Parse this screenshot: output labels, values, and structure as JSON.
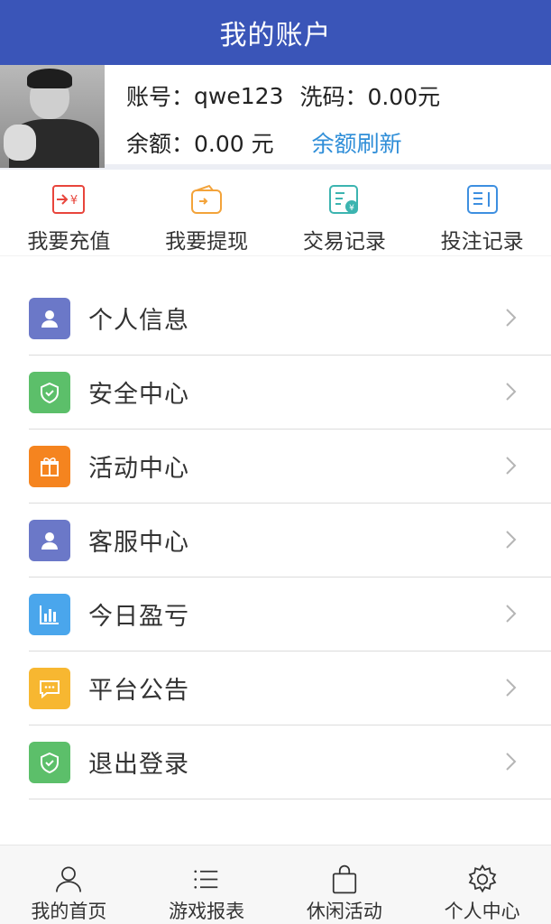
{
  "header": {
    "title": "我的账户"
  },
  "account": {
    "account_label": "账号：",
    "account_value": "qwe123",
    "wash_label": "洗码：",
    "wash_value": "0.00元",
    "balance_label": "余额：",
    "balance_value": "0.00 元",
    "refresh_label": "余额刷新"
  },
  "quick_actions": [
    {
      "label": "我要充值",
      "icon": "recharge-icon",
      "color": "#e8453c"
    },
    {
      "label": "我要提现",
      "icon": "wallet-icon",
      "color": "#f3a33a"
    },
    {
      "label": "交易记录",
      "icon": "transaction-record-icon",
      "color": "#3cb4b0"
    },
    {
      "label": "投注记录",
      "icon": "bet-record-icon",
      "color": "#3d8fe0"
    }
  ],
  "menu": [
    {
      "label": "个人信息",
      "icon": "user-icon",
      "color": "#6b78c8"
    },
    {
      "label": "安全中心",
      "icon": "shield-icon",
      "color": "#5cbf6a"
    },
    {
      "label": "活动中心",
      "icon": "gift-icon",
      "color": "#f5841f"
    },
    {
      "label": "客服中心",
      "icon": "user-icon",
      "color": "#6b78c8"
    },
    {
      "label": "今日盈亏",
      "icon": "bar-chart-icon",
      "color": "#4aa6ec"
    },
    {
      "label": "平台公告",
      "icon": "message-icon",
      "color": "#f7b731"
    },
    {
      "label": "退出登录",
      "icon": "shield-icon",
      "color": "#5cbf6a"
    }
  ],
  "tabbar": [
    {
      "label": "我的首页",
      "icon": "person-icon"
    },
    {
      "label": "游戏报表",
      "icon": "list-icon"
    },
    {
      "label": "休闲活动",
      "icon": "shopping-bag-icon"
    },
    {
      "label": "个人中心",
      "icon": "gear-icon"
    }
  ]
}
